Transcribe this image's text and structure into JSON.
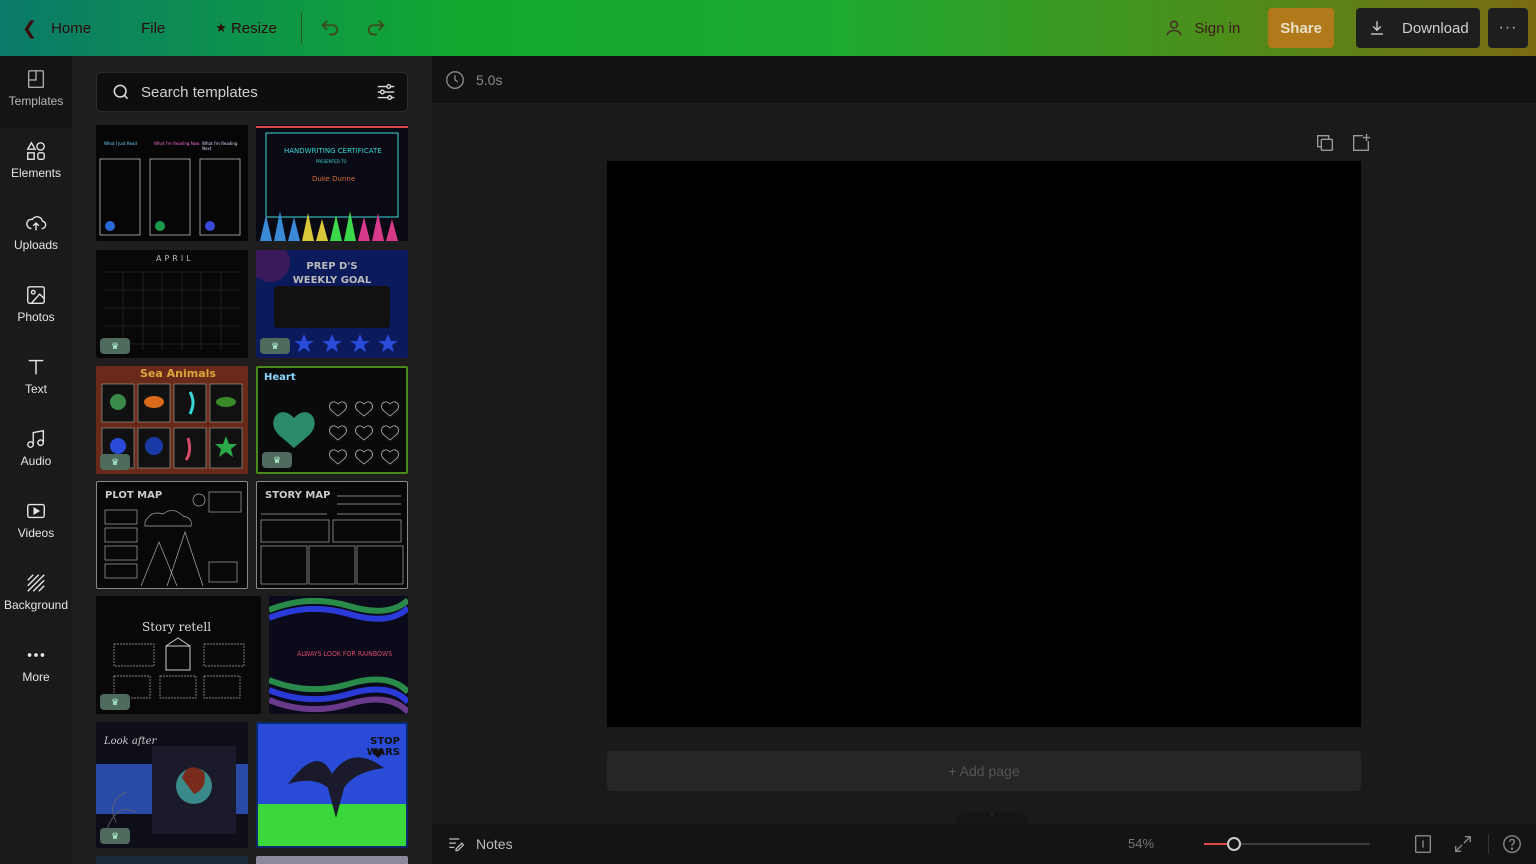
{
  "topbar": {
    "home": "Home",
    "file": "File",
    "resize": "Resize",
    "sign_in": "Sign in",
    "share": "Share",
    "download": "Download",
    "more": "···"
  },
  "rail": {
    "items": [
      {
        "label": "Templates",
        "icon": "templates-icon"
      },
      {
        "label": "Elements",
        "icon": "elements-icon"
      },
      {
        "label": "Uploads",
        "icon": "uploads-icon"
      },
      {
        "label": "Photos",
        "icon": "photos-icon"
      },
      {
        "label": "Text",
        "icon": "text-icon"
      },
      {
        "label": "Audio",
        "icon": "audio-icon"
      },
      {
        "label": "Videos",
        "icon": "videos-icon"
      },
      {
        "label": "Background",
        "icon": "background-icon"
      },
      {
        "label": "More",
        "icon": "more-icon"
      }
    ]
  },
  "search": {
    "placeholder": "Search templates"
  },
  "templates": [
    {
      "title_lines": [
        "What I Just Read",
        "What I'm Reading Now",
        "What I'm Reading Next"
      ],
      "crown": true
    },
    {
      "title": "HANDWRITING CERTIFICATE",
      "sub": "PRESENTED TO",
      "name": "Duke Dunne",
      "crown": false
    },
    {
      "title": "APRIL",
      "crown": true
    },
    {
      "title": "PREP D'S WEEKLY GOAL",
      "crown": true
    },
    {
      "title": "Sea Animals",
      "crown": true
    },
    {
      "title": "Heart",
      "crown": true
    },
    {
      "title": "PLOT MAP",
      "crown": false
    },
    {
      "title": "STORY MAP",
      "crown": false
    },
    {
      "title": "Story retell",
      "crown": true
    },
    {
      "title": "ALWAYS LOOK FOR RAINBOWS",
      "crown": false
    },
    {
      "title": "Look after",
      "crown": true
    },
    {
      "title": "STOP WARS",
      "crown": false
    }
  ],
  "editor": {
    "timer": "5.0s",
    "add_page": "+ Add page"
  },
  "bottombar": {
    "notes": "Notes",
    "zoom": "54%",
    "zoom_fraction": 0.18
  },
  "colors": {
    "topbar_gradient_start": "#0a7a6a",
    "topbar_gradient_end": "#7b6a12",
    "share": "#b07a1a",
    "page": "#000000",
    "slider_fill": "#e04a4a"
  }
}
